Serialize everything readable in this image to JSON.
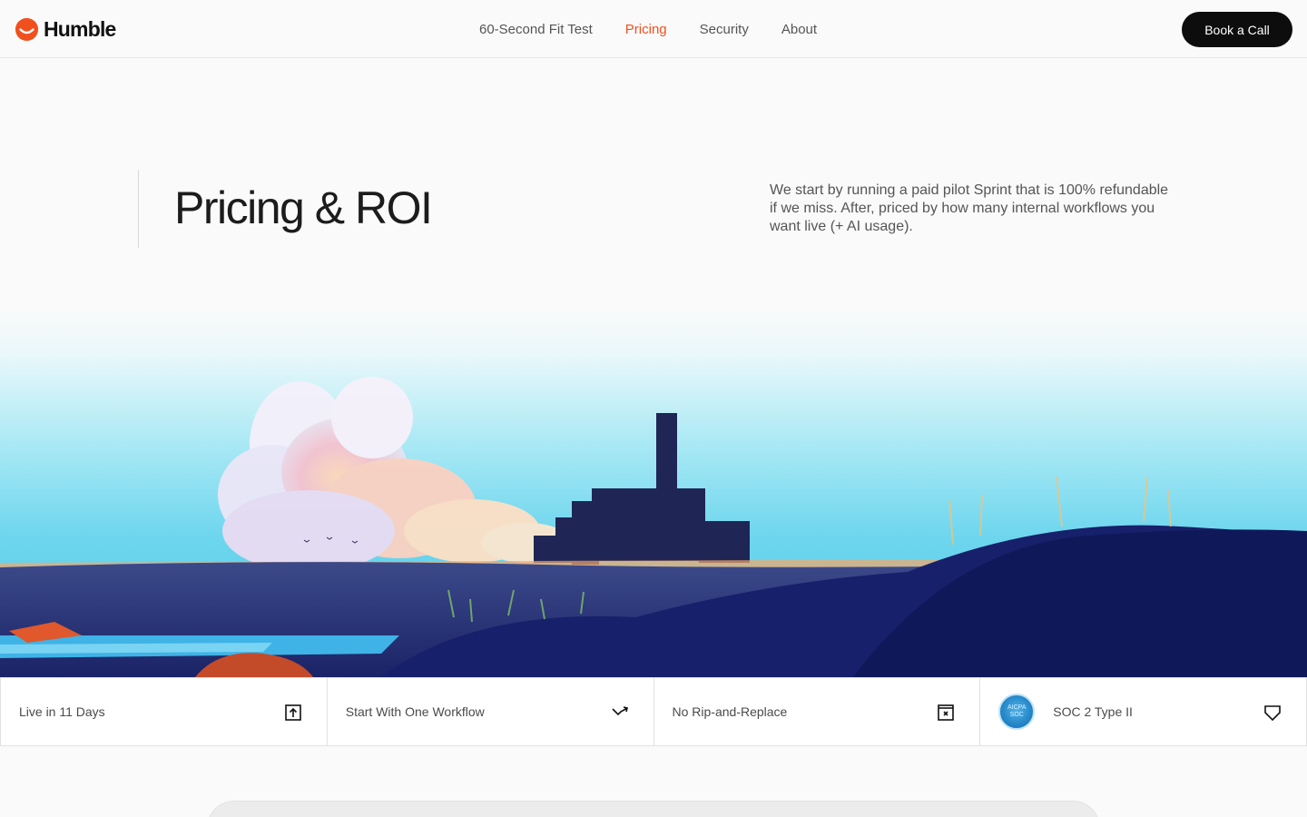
{
  "brand": {
    "name": "Humble",
    "accent": "#f0501e"
  },
  "nav": {
    "items": [
      {
        "label": "60-Second Fit Test",
        "active": false
      },
      {
        "label": "Pricing",
        "active": true
      },
      {
        "label": "Security",
        "active": false
      },
      {
        "label": "About",
        "active": false
      }
    ],
    "cta_label": "Book a Call"
  },
  "hero": {
    "title": "Pricing & ROI",
    "description": "We start by running a paid pilot Sprint that is 100% refundable if we miss. After, priced by how many internal workflows you want live (+ AI usage)."
  },
  "features": [
    {
      "label": "Live in 11 Days",
      "icon": "arrow-up-box-icon"
    },
    {
      "label": "Start With One Workflow",
      "icon": "trend-down-icon"
    },
    {
      "label": "No Rip-and-Replace",
      "icon": "box-x-icon"
    },
    {
      "label": "SOC 2 Type II",
      "icon": "shield-icon",
      "badge": {
        "line1": "AICPA",
        "line2": "SOC"
      }
    }
  ]
}
